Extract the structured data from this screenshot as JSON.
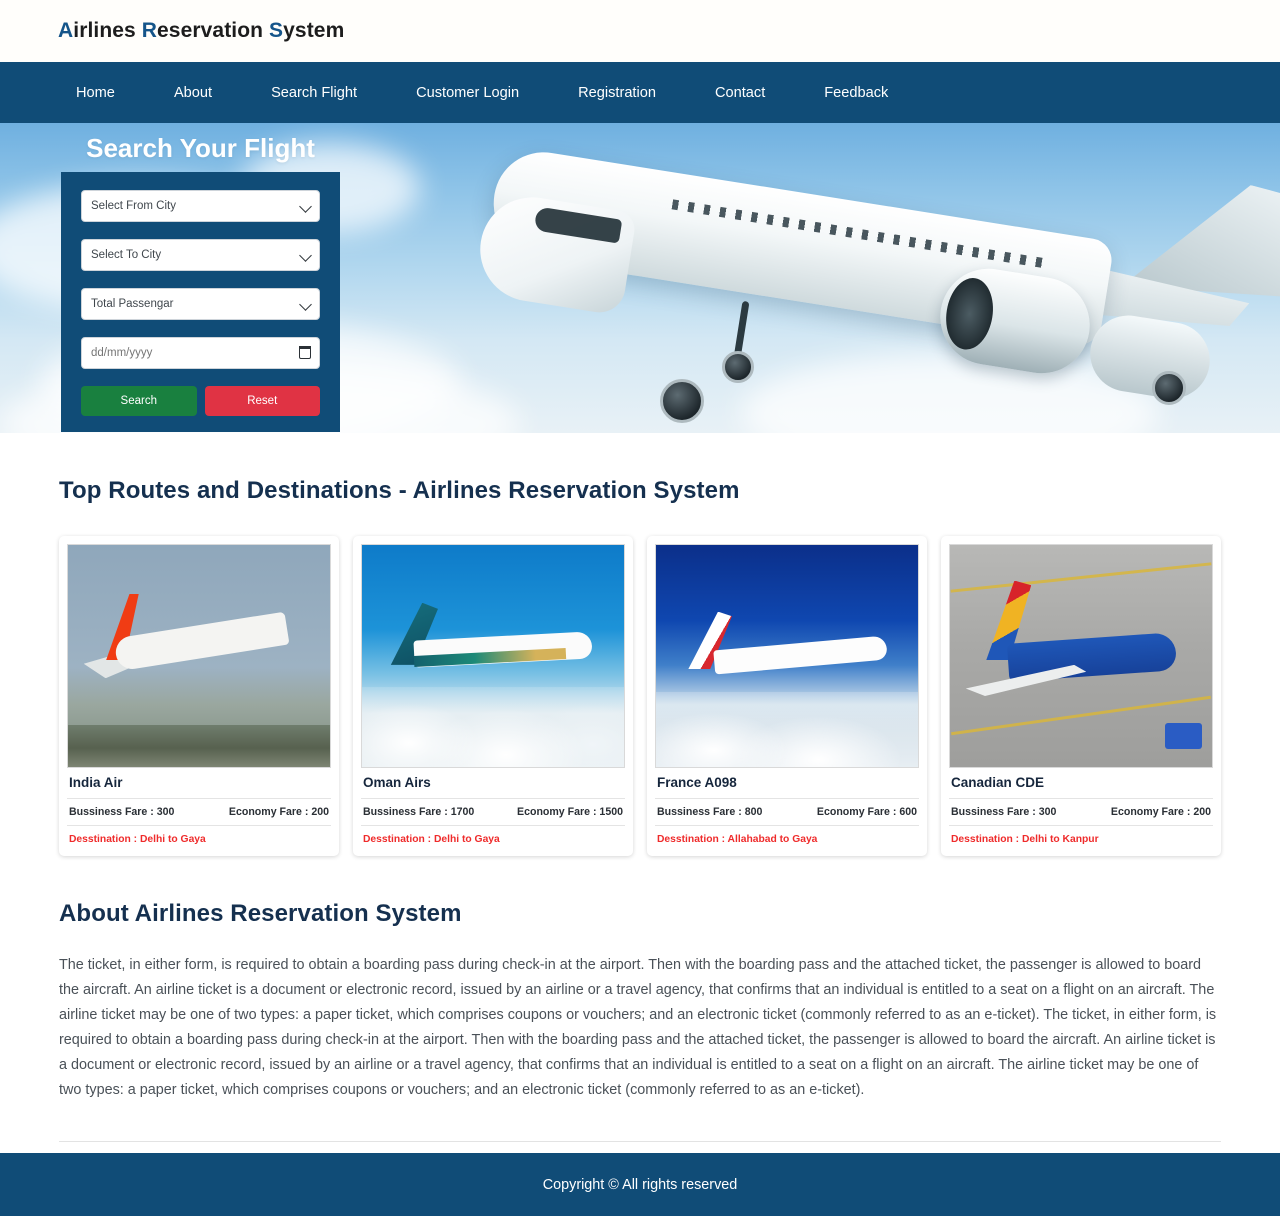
{
  "brand": {
    "part1": "A",
    "word1": "irlines ",
    "part2": "R",
    "word2": "eservation ",
    "part3": "S",
    "word3": "ystem",
    "full": "Airlines Reservation System",
    "highlight_color": "#15558a"
  },
  "nav": {
    "items": [
      {
        "label": "Home"
      },
      {
        "label": "About"
      },
      {
        "label": "Search Flight"
      },
      {
        "label": "Customer Login"
      },
      {
        "label": "Registration"
      },
      {
        "label": "Contact"
      },
      {
        "label": "Feedback"
      }
    ],
    "background_color": "#104c77"
  },
  "hero": {
    "search": {
      "title": "Search Your Flight",
      "from_city_placeholder": "Select From City",
      "to_city_placeholder": "Select To City",
      "passenger_placeholder": "Total Passengar",
      "date_placeholder": "dd/mm/yyyy",
      "date_value": "",
      "search_button": "Search",
      "reset_button": "Reset",
      "search_button_color": "#19803f",
      "reset_button_color": "#e03344",
      "panel_color": "#104c77"
    }
  },
  "routes": {
    "title": "Top Routes and Destinations - Airlines Reservation System",
    "fare_separator": " : ",
    "cards": [
      {
        "name": "India Air",
        "business_fare": "Bussiness Fare : 300",
        "economy_fare": "Economy Fare : 200",
        "destination": "Desstination : Delhi to Gaya",
        "image_alt": "india-air-aircraft-photo"
      },
      {
        "name": "Oman Airs",
        "business_fare": "Bussiness Fare : 1700",
        "economy_fare": "Economy Fare : 1500",
        "destination": "Desstination : Delhi to Gaya",
        "image_alt": "oman-airs-aircraft-photo"
      },
      {
        "name": "France A098",
        "business_fare": "Bussiness Fare : 800",
        "economy_fare": "Economy Fare : 600",
        "destination": "Desstination : Allahabad to Gaya",
        "image_alt": "air-france-aircraft-photo"
      },
      {
        "name": "Canadian CDE",
        "business_fare": "Bussiness Fare : 300",
        "economy_fare": "Economy Fare : 200",
        "destination": "Desstination : Delhi to Kanpur",
        "image_alt": "southwest-aircraft-photo"
      }
    ]
  },
  "about": {
    "title": "About Airlines Reservation System",
    "body": "The ticket, in either form, is required to obtain a boarding pass during check-in at the airport. Then with the boarding pass and the attached ticket, the passenger is allowed to board the aircraft. An airline ticket is a document or electronic record, issued by an airline or a travel agency, that confirms that an individual is entitled to a seat on a flight on an aircraft. The airline ticket may be one of two types: a paper ticket, which comprises coupons or vouchers; and an electronic ticket (commonly referred to as an e-ticket). The ticket, in either form, is required to obtain a boarding pass during check-in at the airport. Then with the boarding pass and the attached ticket, the passenger is allowed to board the aircraft. An airline ticket is a document or electronic record, issued by an airline or a travel agency, that confirms that an individual is entitled to a seat on a flight on an aircraft. The airline ticket may be one of two types: a paper ticket, which comprises coupons or vouchers; and an electronic ticket (commonly referred to as an e-ticket)."
  },
  "footer": {
    "copyright": "Copyright © All rights reserved",
    "background_color": "#104c77"
  }
}
